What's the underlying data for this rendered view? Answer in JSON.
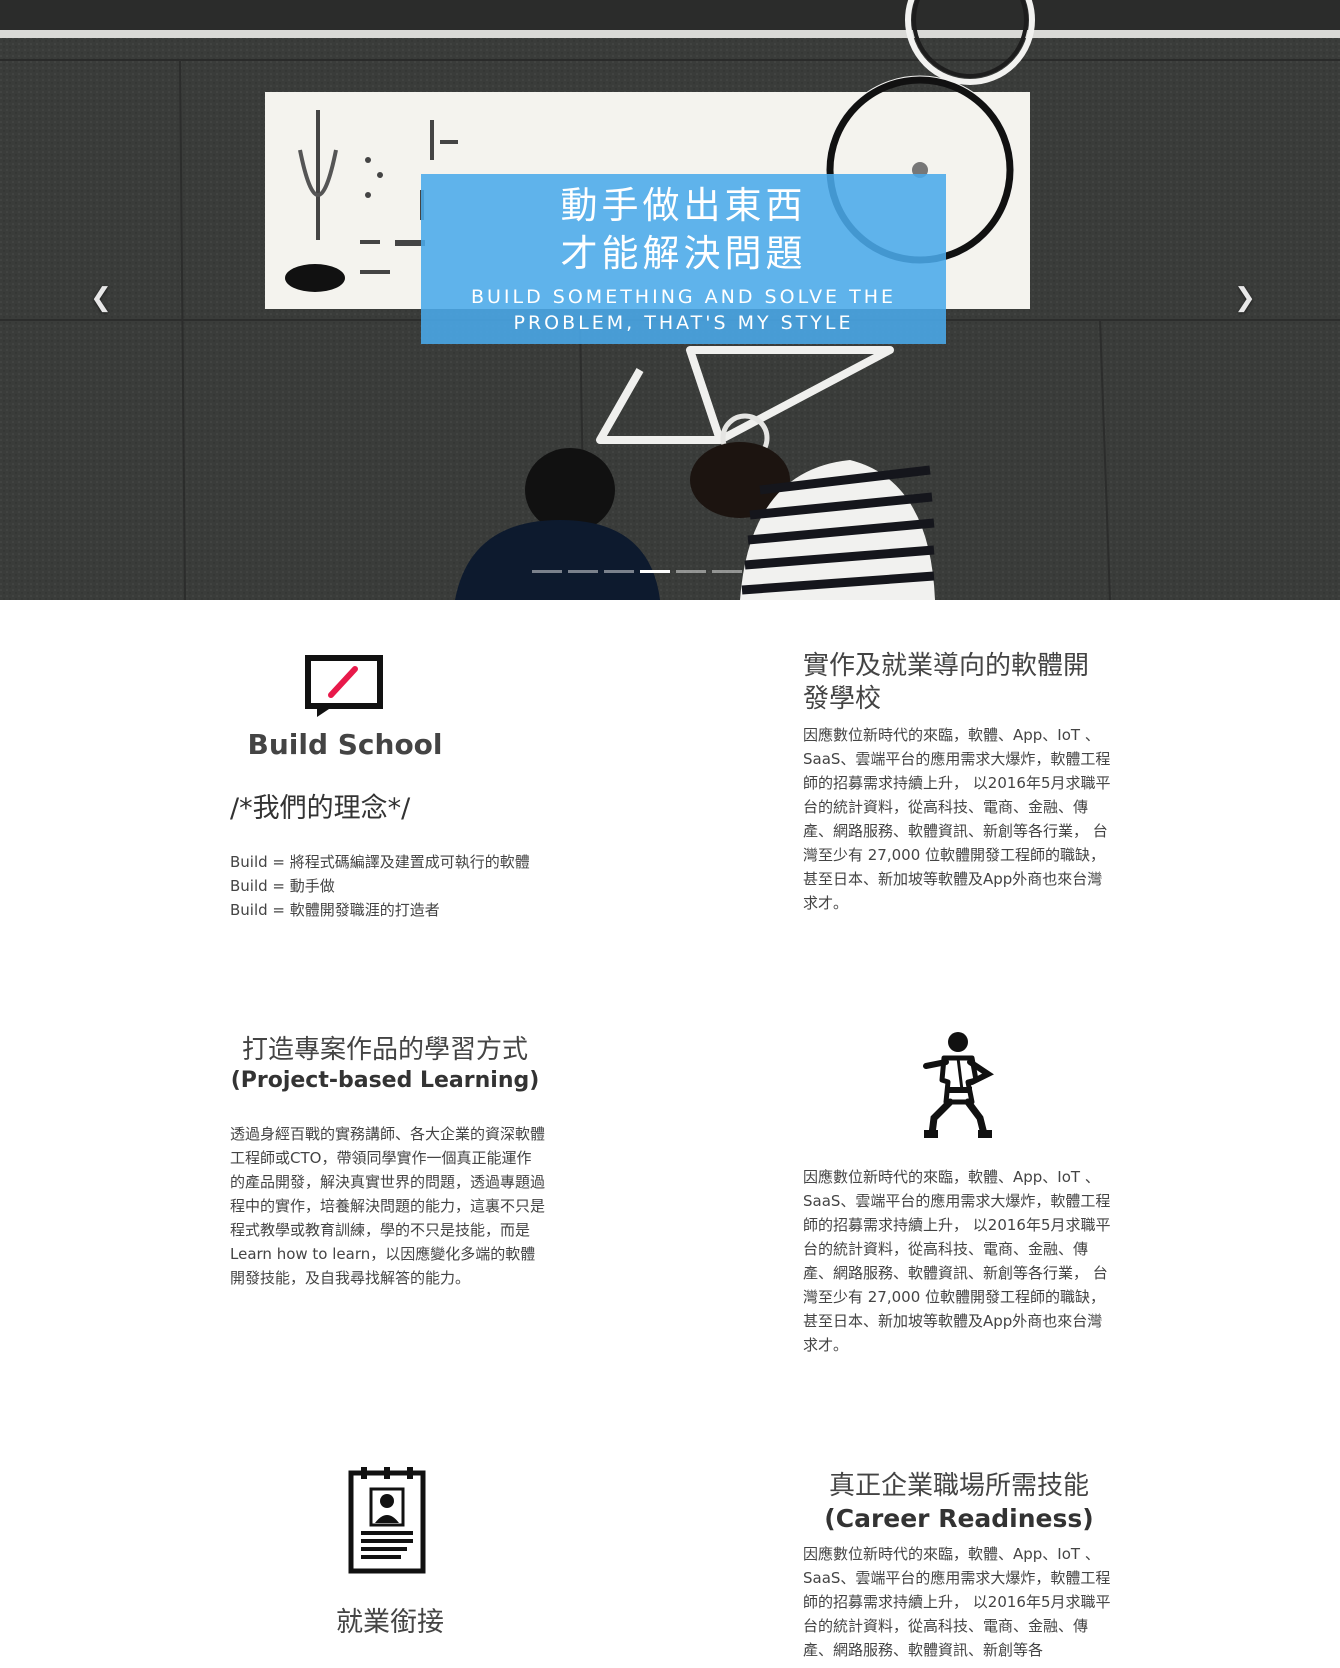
{
  "hero": {
    "caption_zh_line1": "動手做出東西",
    "caption_zh_line2": "才能解決問題",
    "caption_en_line1": "BUILD SOMETHING AND SOLVE THE",
    "caption_en_line2": "PROBLEM, THAT'S MY STYLE",
    "prev_label": "❮",
    "next_label": "❯",
    "indicator_count": 6,
    "active_indicator": 4,
    "caption_bg": "#4aaaea"
  },
  "intro": {
    "brand": "Build School",
    "philosophy_title": "/*我們的理念*/",
    "philosophy_items": [
      "Build = 將程式碼編譯及建置成可執行的軟體",
      "Build = 動手做",
      "Build = 軟體開發職涯的打造者"
    ]
  },
  "section_software_school": {
    "title_line1": "實作及就業導向的軟體開",
    "title_line2": "發學校",
    "body": "因應數位新時代的來臨，軟體、App、IoT 、SaaS、雲端平台的應用需求大爆炸，軟體工程師的招募需求持續上升， 以2016年5月求職平台的統計資料，從高科技、電商、金融、傳產、網路服務、軟體資訊、新創等各行業， 台灣至少有 27,000 位軟體開發工程師的職缺，甚至日本、新加坡等軟體及App外商也來台灣求才。"
  },
  "section_project": {
    "title_zh": "打造專案作品的學習方式",
    "title_en": "(Project-based Learning)",
    "body": "透過身經百戰的實務講師、各大企業的資深軟體工程師或CTO，帶領同學實作一個真正能運作的產品開發，解決真實世界的問題，透過專題過程中的實作，培養解決問題的能力，這裏不只是程式教學或教育訓練，學的不只是技能，而是 Learn how to learn，以因應變化多端的軟體開發技能，及自我尋找解答的能力。",
    "right_body": "因應數位新時代的來臨，軟體、App、IoT 、SaaS、雲端平台的應用需求大爆炸，軟體工程師的招募需求持續上升， 以2016年5月求職平台的統計資料，從高科技、電商、金融、傳產、網路服務、軟體資訊、新創等各行業， 台灣至少有 27,000 位軟體開發工程師的職缺，甚至日本、新加坡等軟體及App外商也來台灣求才。"
  },
  "section_career": {
    "title_zh": "真正企業職場所需技能",
    "title_en": "(Career Readiness)",
    "body": "因應數位新時代的來臨，軟體、App、IoT 、SaaS、雲端平台的應用需求大爆炸，軟體工程師的招募需求持續上升， 以2016年5月求職平台的統計資料，從高科技、電商、金融、傳產、網路服務、軟體資訊、新創等各",
    "left_title": "就業銜接"
  },
  "icons": {
    "brand_icon": "speech-bubble-slash-icon",
    "karate_icon": "martial-arts-person-icon",
    "resume_icon": "resume-clipboard-icon",
    "accent": "#e8194a"
  }
}
